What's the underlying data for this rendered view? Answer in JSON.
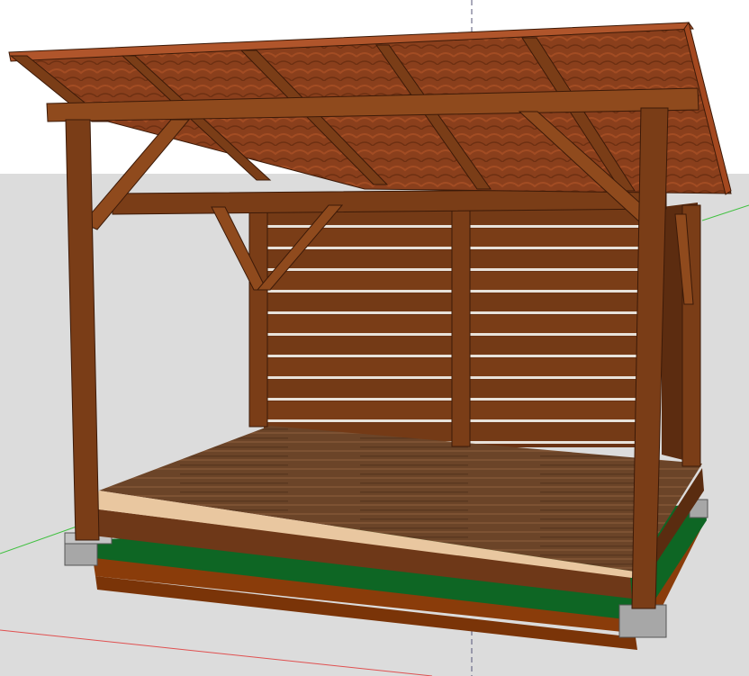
{
  "viewport": {
    "background_sky": "#ffffff",
    "background_ground": "#dcdcdc"
  },
  "model": {
    "subject": "woodshed",
    "colors": {
      "wood_dark": "#5e2e12",
      "wood_mid": "#7a3d17",
      "wood_light": "#8f4a1d",
      "roof_tile": "#8a3f1c",
      "roof_edge": "#b0552b",
      "floor": "#6b4428",
      "floor_stripe": "#7d5233",
      "trim_cream": "#e9c7a0",
      "base_green": "#0e6624",
      "base_brown": "#8a3c0a",
      "pier": "#a7a7a7",
      "axis_red": "#e05050",
      "axis_green": "#40c040",
      "axis_blue": "#555577"
    }
  }
}
